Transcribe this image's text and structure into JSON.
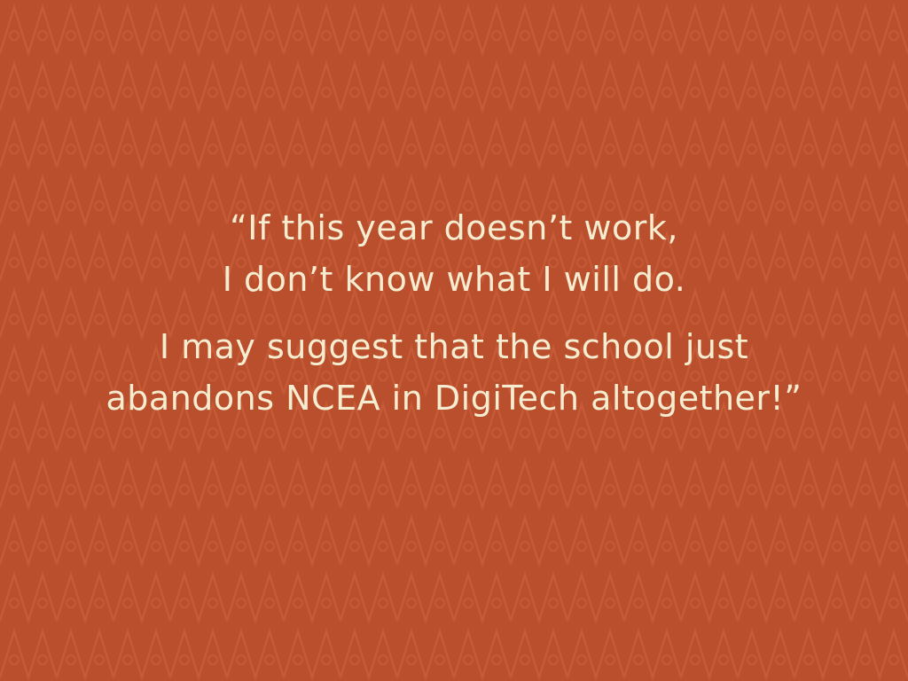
{
  "quote": {
    "paragraphs": [
      {
        "lines": [
          "“If this year doesn’t work,",
          "I don’t know what I will do."
        ]
      },
      {
        "lines": [
          "I may suggest that the school just",
          "abandons NCEA in DigiTech altogether!”"
        ]
      }
    ]
  },
  "colors": {
    "background": "#b94f2d",
    "pattern": "#c65a37",
    "text": "#f6ecd0"
  }
}
